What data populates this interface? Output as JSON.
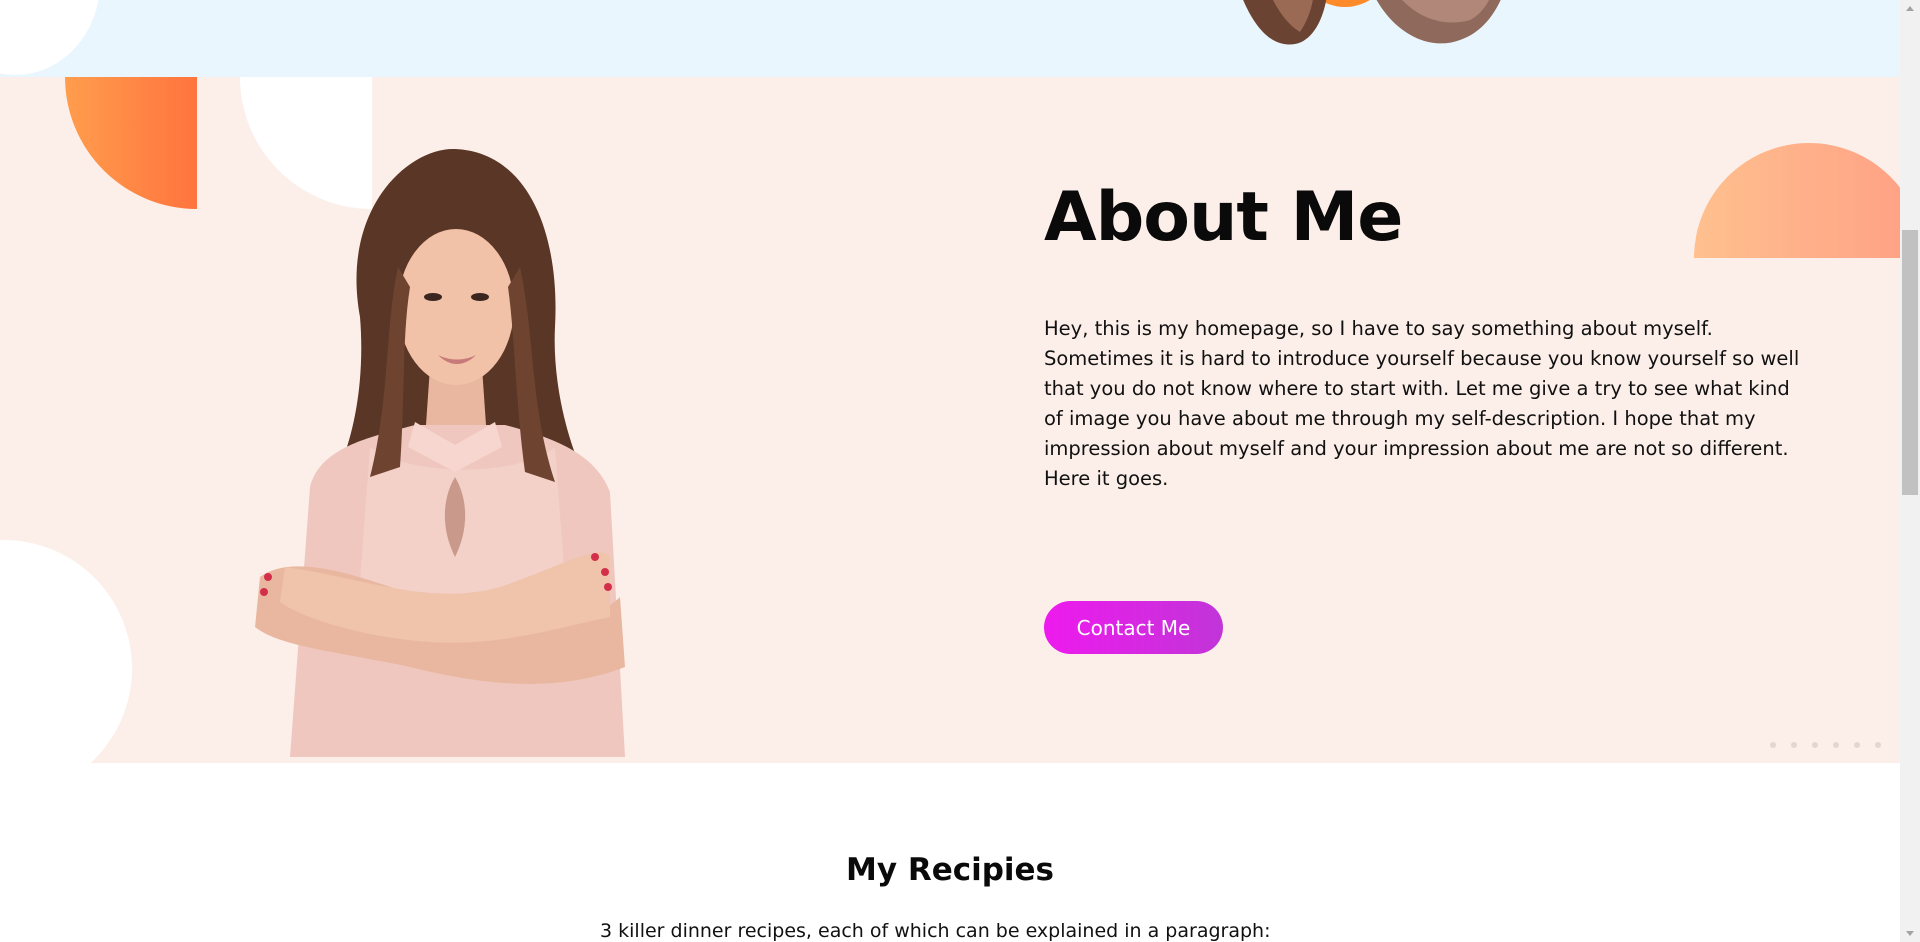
{
  "about": {
    "title": "About Me",
    "text": "Hey, this is my homepage, so I have to say something about myself. Sometimes it is hard to introduce yourself because you know yourself so well that you do not know where to start with. Let me give a try to see what kind of image you have about me through my self-description. I hope that my impression about myself and your impression about me are not so different. Here it goes.",
    "contact_label": "Contact Me",
    "button_gradient": [
      "#ee1aee",
      "#c135d8"
    ]
  },
  "recipes": {
    "title": "My Recipies",
    "subtitle": "3 killer dinner recipes, each of which can be explained in a paragraph:"
  },
  "colors": {
    "hero_bg": "#eaf6fd",
    "about_bg": "#fcefe9",
    "accent_orange": "#ff4a2f",
    "accent_peach": "#ffc08e"
  },
  "icons": {
    "portrait": "woman-portrait-image",
    "dots": "dots-pattern"
  }
}
